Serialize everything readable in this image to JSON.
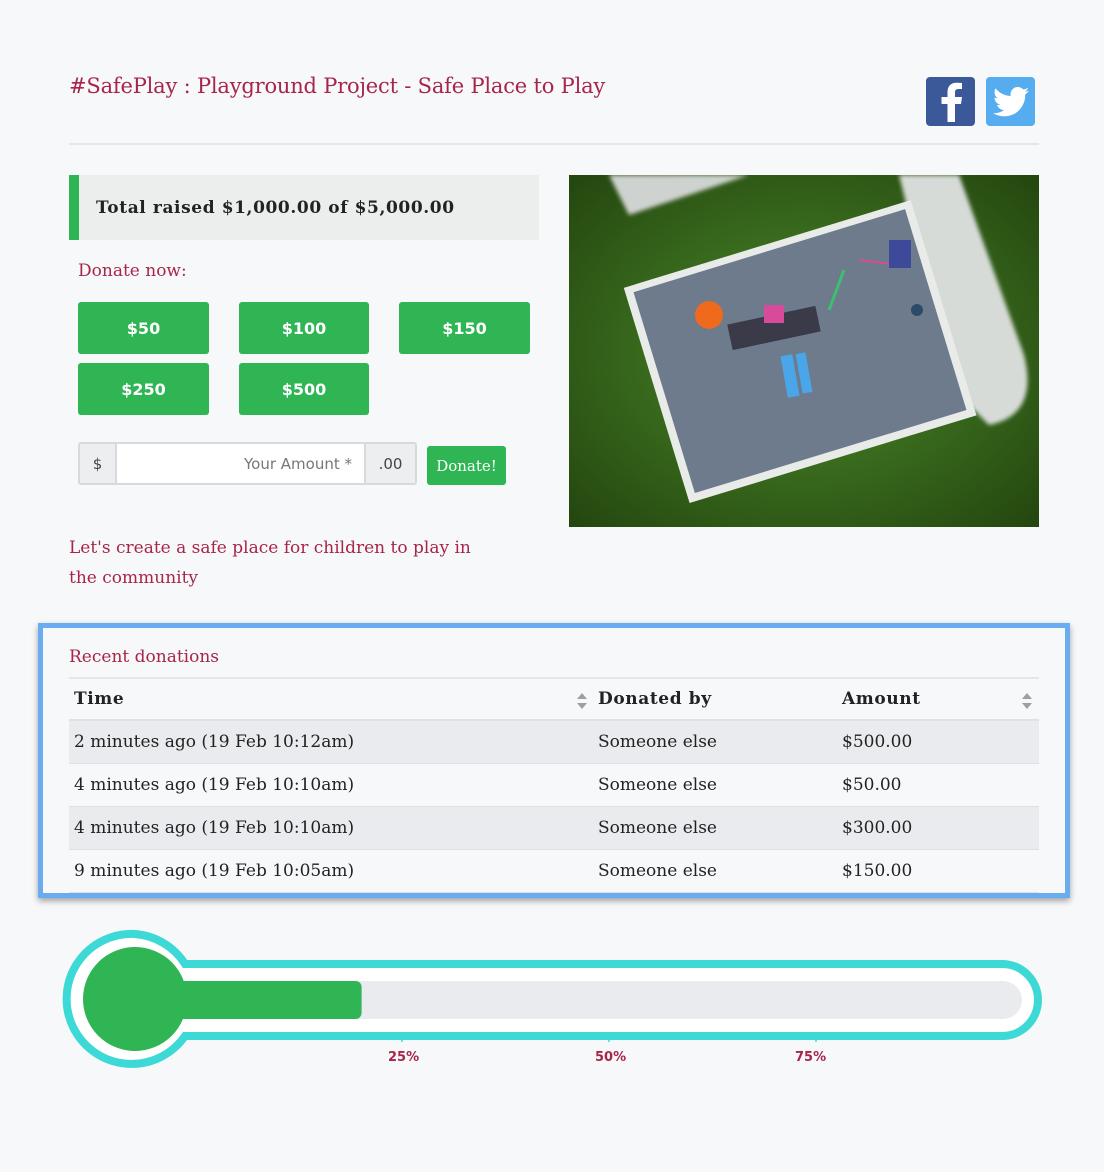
{
  "header": {
    "title": "#SafePlay : Playground Project - Safe Place to Play",
    "social": [
      "facebook-icon",
      "twitter-icon"
    ]
  },
  "fundraiser": {
    "total_label": "Total raised $1,000.00 of $5,000.00",
    "donate_label": "Donate now:",
    "amounts": [
      "$50",
      "$100",
      "$150",
      "$250",
      "$500"
    ],
    "currency_symbol": "$",
    "amount_placeholder": "Your Amount *",
    "cents_suffix": ".00",
    "donate_button": "Donate!",
    "tagline": "Let's create a safe place for children to play in the community",
    "progress_fraction": 0.2
  },
  "donations": {
    "title": "Recent donations",
    "columns": [
      "Time",
      "Donated by",
      "Amount"
    ],
    "rows": [
      [
        "2 minutes ago (19 Feb 10:12am)",
        "Someone else",
        "$500.00"
      ],
      [
        "4 minutes ago (19 Feb 10:10am)",
        "Someone else",
        "$50.00"
      ],
      [
        "4 minutes ago (19 Feb 10:10am)",
        "Someone else",
        "$300.00"
      ],
      [
        "9 minutes ago (19 Feb 10:05am)",
        "Someone else",
        "$150.00"
      ]
    ]
  },
  "thermometer": {
    "ticks": [
      "25%",
      "50%",
      "75%"
    ]
  },
  "colors": {
    "accent": "#a8254a",
    "green": "#2fb554",
    "teal": "#3dd9d6",
    "facebook": "#3b5998",
    "twitter": "#55acee",
    "highlight_border": "#6aacef"
  }
}
